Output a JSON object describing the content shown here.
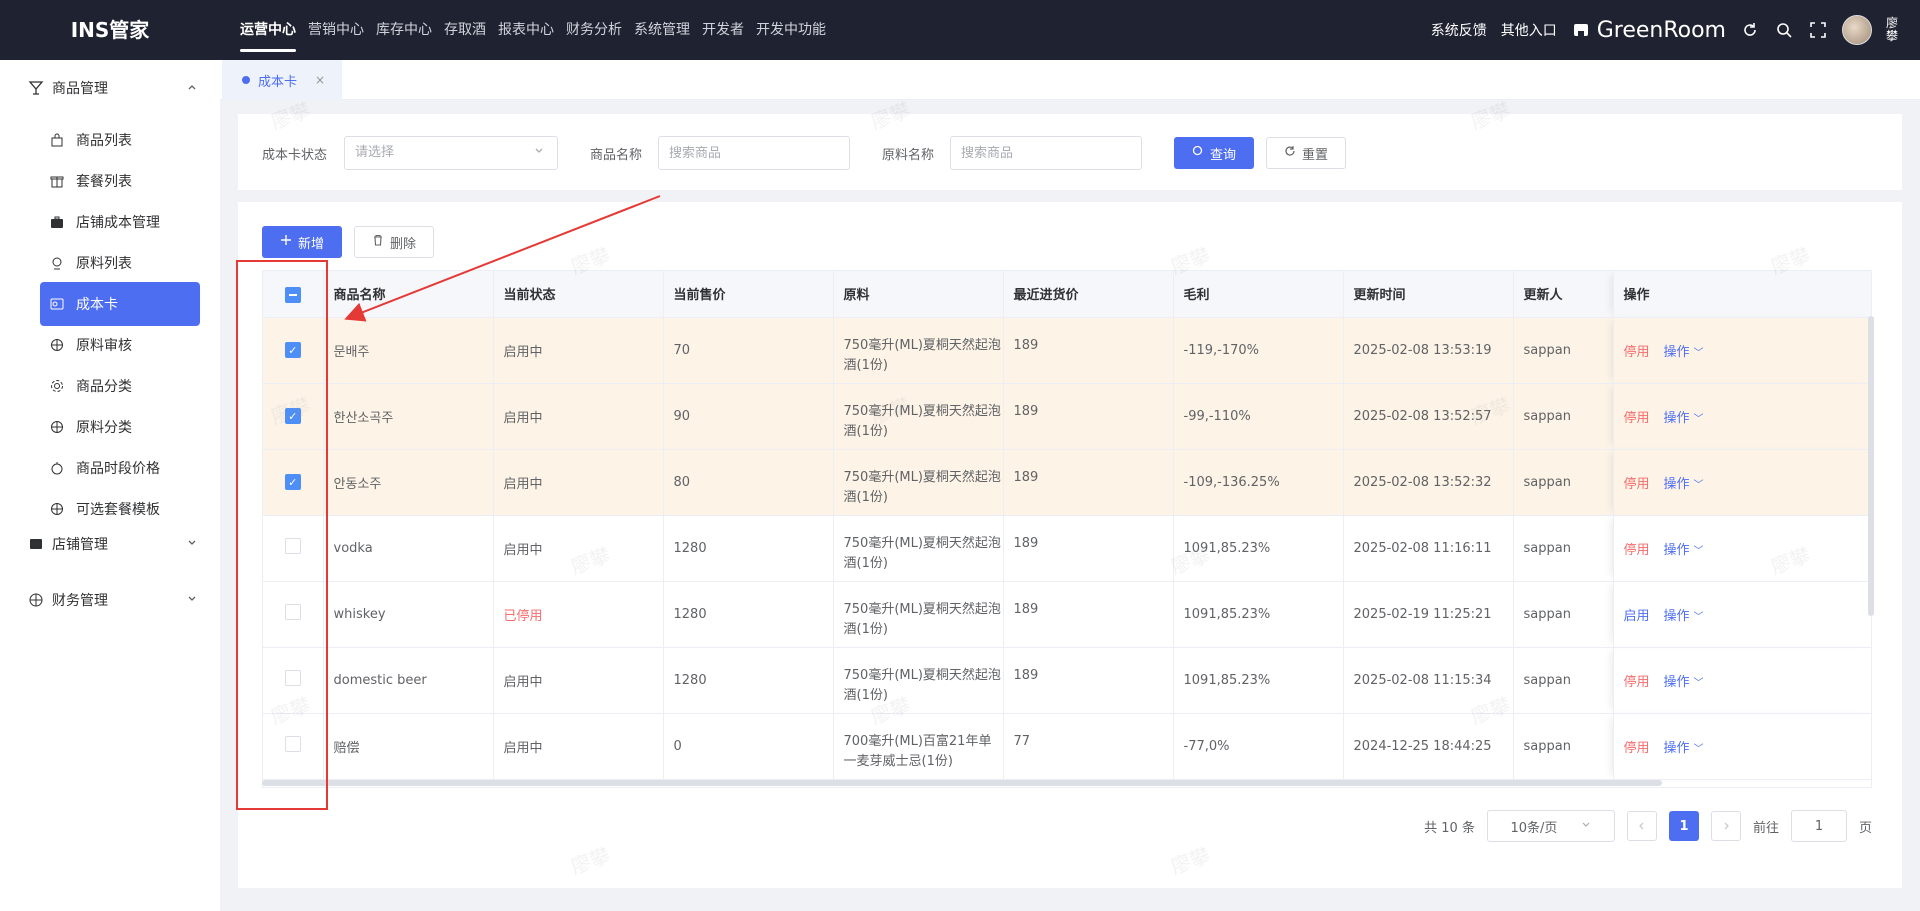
{
  "app": {
    "title": "INS管家"
  },
  "topnav": [
    "运营中心",
    "营销中心",
    "库存中心",
    "存取酒",
    "报表中心",
    "财务分析",
    "系统管理",
    "开发者",
    "开发中功能"
  ],
  "topbar_right": {
    "feedback": "系统反馈",
    "other_entry": "其他入口",
    "store_name": "GreenRoom",
    "user_name": "廖攀"
  },
  "sidebar": {
    "group_goods": "商品管理",
    "items": [
      "商品列表",
      "套餐列表",
      "店铺成本管理",
      "原料列表",
      "成本卡",
      "原料审核",
      "商品分类",
      "原料分类",
      "商品时段价格",
      "可选套餐模板"
    ],
    "group_store": "店铺管理",
    "group_finance": "财务管理"
  },
  "tab": {
    "label": "成本卡",
    "close": "×"
  },
  "filters": {
    "status_label": "成本卡状态",
    "status_placeholder": "请选择",
    "product_label": "商品名称",
    "product_placeholder": "搜索商品",
    "material_label": "原料名称",
    "material_placeholder": "搜索商品",
    "query_button": "查询",
    "reset_button": "重置"
  },
  "toolbar": {
    "add_button": "新增",
    "delete_button": "删除"
  },
  "table": {
    "headers": [
      "商品名称",
      "当前状态",
      "当前售价",
      "原料",
      "最近进货价",
      "毛利",
      "更新时间",
      "更新人",
      "操作"
    ],
    "rows": [
      {
        "name": "문배주",
        "status": "启用中",
        "price": "70",
        "material": "750毫升(ML)夏桐天然起泡酒(1份)",
        "cost": "189",
        "margin": "-119,-170%",
        "updated": "2025-02-08 13:53:19",
        "updater": "sappan",
        "action": "停用",
        "op": "操作"
      },
      {
        "name": "한산소곡주",
        "status": "启用中",
        "price": "90",
        "material": "750毫升(ML)夏桐天然起泡酒(1份)",
        "cost": "189",
        "margin": "-99,-110%",
        "updated": "2025-02-08 13:52:57",
        "updater": "sappan",
        "action": "停用",
        "op": "操作"
      },
      {
        "name": "안동소주",
        "status": "启用中",
        "price": "80",
        "material": "750毫升(ML)夏桐天然起泡酒(1份)",
        "cost": "189",
        "margin": "-109,-136.25%",
        "updated": "2025-02-08 13:52:32",
        "updater": "sappan",
        "action": "停用",
        "op": "操作"
      },
      {
        "name": "vodka",
        "status": "启用中",
        "price": "1280",
        "material": "750毫升(ML)夏桐天然起泡酒(1份)",
        "cost": "189",
        "margin": "1091,85.23%",
        "updated": "2025-02-08 11:16:11",
        "updater": "sappan",
        "action": "停用",
        "op": "操作"
      },
      {
        "name": "whiskey",
        "status": "已停用",
        "price": "1280",
        "material": "750毫升(ML)夏桐天然起泡酒(1份)",
        "cost": "189",
        "margin": "1091,85.23%",
        "updated": "2025-02-19 11:25:21",
        "updater": "sappan",
        "action": "启用",
        "op": "操作"
      },
      {
        "name": "domestic beer",
        "status": "启用中",
        "price": "1280",
        "material": "750毫升(ML)夏桐天然起泡酒(1份)",
        "cost": "189",
        "margin": "1091,85.23%",
        "updated": "2025-02-08 11:15:34",
        "updater": "sappan",
        "action": "停用",
        "op": "操作"
      },
      {
        "name": "赔偿",
        "status": "启用中",
        "price": "0",
        "material": "700毫升(ML)百富21年单一麦芽威士忌(1份)",
        "cost": "77",
        "margin": "-77,0%",
        "updated": "2024-12-25 18:44:25",
        "updater": "sappan",
        "action": "停用",
        "op": "操作"
      }
    ]
  },
  "pagination": {
    "total": "共 10 条",
    "page_size": "10条/页",
    "current_page": "1",
    "goto_label": "前往",
    "goto_value": "1",
    "page_suffix": "页"
  },
  "watermark": "廖攀",
  "colors": {
    "primary": "#4e6ef2",
    "danger": "#f56c6c",
    "annotation": "#e53935",
    "topbar": "#1f2230"
  }
}
